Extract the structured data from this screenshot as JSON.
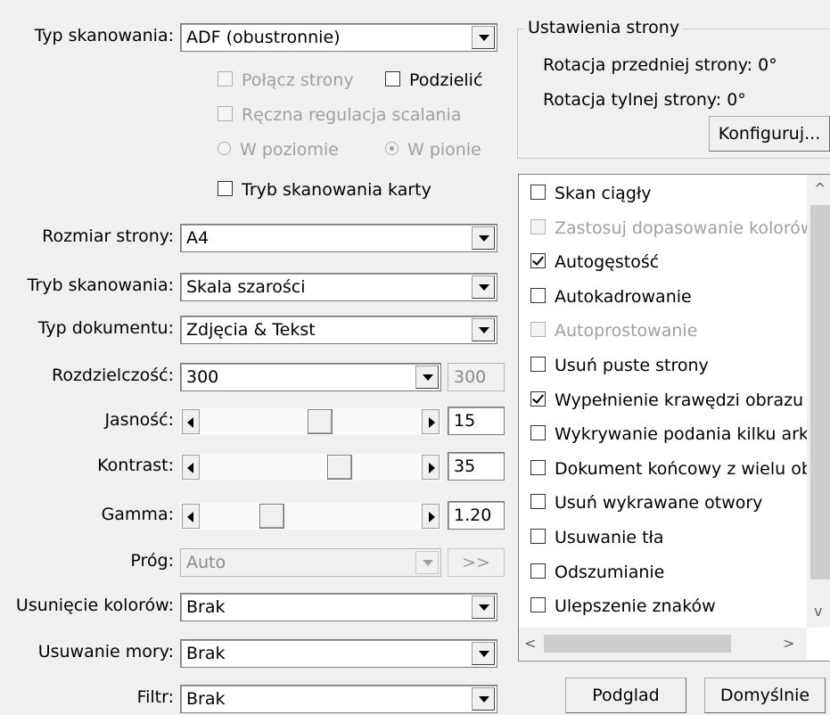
{
  "left": {
    "scan_type": {
      "label": "Typ skanowania:",
      "value": "ADF (obustronnie)"
    },
    "merge_pages": "Połącz strony",
    "split": "Podzielić",
    "manual_merge": "Ręczna regulacja scalania",
    "horizontal": "W poziomie",
    "vertical": "W pionie",
    "card_mode": "Tryb skanowania karty",
    "page_size": {
      "label": "Rozmiar strony:",
      "value": "A4"
    },
    "scan_mode": {
      "label": "Tryb skanowania:",
      "value": "Skala szarości"
    },
    "doc_type": {
      "label": "Typ dokumentu:",
      "value": "Zdjęcia & Tekst"
    },
    "resolution": {
      "label": "Rozdzielczość:",
      "value": "300",
      "custom": "300"
    },
    "brightness": {
      "label": "Jasność:",
      "value": "15"
    },
    "contrast": {
      "label": "Kontrast:",
      "value": "35"
    },
    "gamma": {
      "label": "Gamma:",
      "value": "1.20"
    },
    "threshold": {
      "label": "Próg:",
      "value": "Auto",
      "more": ">>"
    },
    "color_drop": {
      "label": "Usunięcie kolorów:",
      "value": "Brak"
    },
    "moire": {
      "label": "Usuwanie mory:",
      "value": "Brak"
    },
    "filter": {
      "label": "Filtr:",
      "value": "Brak"
    }
  },
  "page_settings": {
    "title": "Ustawienia strony",
    "front_rotation": "Rotacja przedniej strony: 0°",
    "back_rotation": "Rotacja tylnej strony: 0°",
    "configure": "Konfiguruj..."
  },
  "options": [
    {
      "label": "Skan ciągły",
      "checked": false,
      "disabled": false
    },
    {
      "label": "Zastosuj dopasowanie kolorów",
      "checked": false,
      "disabled": true
    },
    {
      "label": "Autogęstość",
      "checked": true,
      "disabled": false
    },
    {
      "label": "Autokadrowanie",
      "checked": false,
      "disabled": false
    },
    {
      "label": "Autoprostowanie",
      "checked": false,
      "disabled": true
    },
    {
      "label": "Usuń puste strony",
      "checked": false,
      "disabled": false
    },
    {
      "label": "Wypełnienie krawędzi obrazu",
      "checked": true,
      "disabled": false
    },
    {
      "label": "Wykrywanie podania kilku arkuszy",
      "checked": false,
      "disabled": false
    },
    {
      "label": "Dokument końcowy z wielu obrazów",
      "checked": false,
      "disabled": false
    },
    {
      "label": "Usuń wykrawane otwory",
      "checked": false,
      "disabled": false
    },
    {
      "label": "Usuwanie tła",
      "checked": false,
      "disabled": false
    },
    {
      "label": "Odszumianie",
      "checked": false,
      "disabled": false
    },
    {
      "label": "Ulepszenie znaków",
      "checked": false,
      "disabled": false
    }
  ],
  "buttons": {
    "preview": "Podglad",
    "defaults": "Domyślnie"
  }
}
